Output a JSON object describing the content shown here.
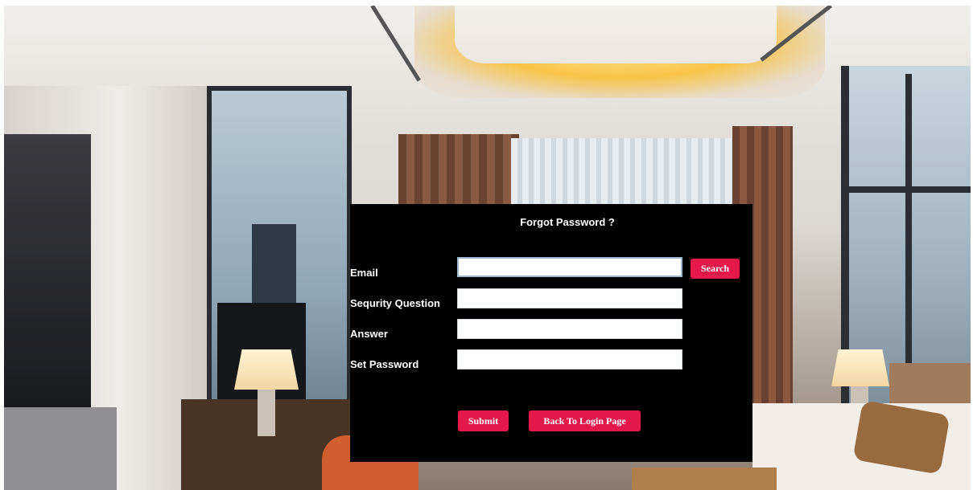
{
  "dialog": {
    "title": "Forgot Password ?",
    "fields": {
      "email": {
        "label": "Email",
        "value": ""
      },
      "security_question": {
        "label": "Sequrity Question",
        "value": ""
      },
      "answer": {
        "label": "Answer",
        "value": ""
      },
      "set_password": {
        "label": "Set Password",
        "value": ""
      }
    },
    "buttons": {
      "search": "Search",
      "submit": "Submit",
      "back": "Back To Login Page"
    }
  },
  "colors": {
    "dialog_background": "#000000",
    "button": "#e5184a",
    "text": "#ffffff"
  }
}
